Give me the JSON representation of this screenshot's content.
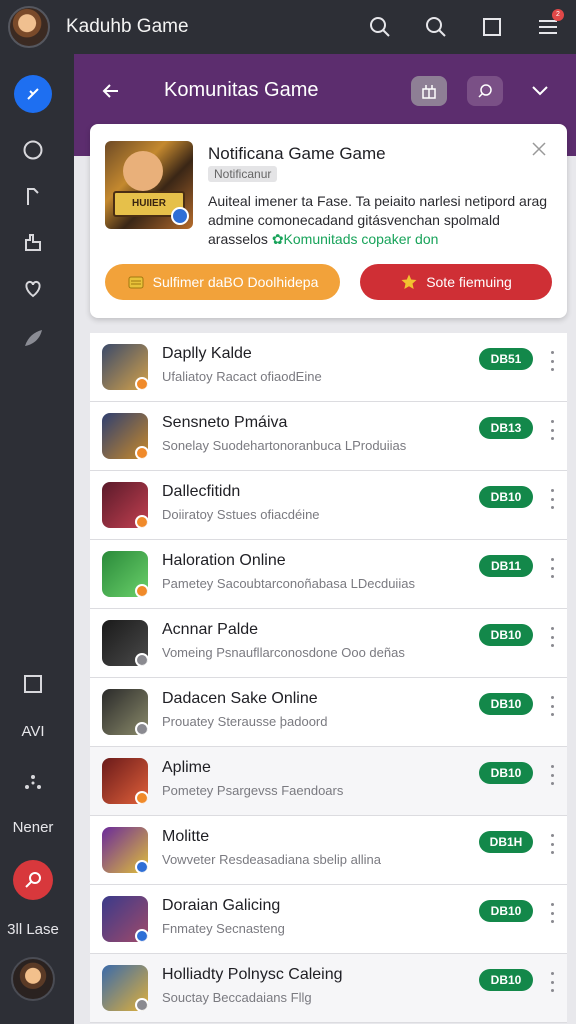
{
  "app_title": "Kaduhb Game",
  "topbar": {
    "icons": [
      "search-icon",
      "search-icon",
      "square-icon",
      "menu-icon"
    ],
    "badge": "2"
  },
  "rail": {
    "labels": {
      "avi": "AVI",
      "nener": "Nener",
      "lase": "3ll Lase"
    },
    "icons": [
      "compass-icon",
      "circle-icon",
      "bookmark-icon",
      "thumb-icon",
      "heart-icon",
      "leaf-icon",
      "square-icon",
      "dots-icon",
      "search-red-icon",
      "avatar"
    ]
  },
  "header": {
    "back_icon": "arrow-left-icon",
    "title": "Komunitas Game"
  },
  "notification": {
    "title": "Notificana Game Game",
    "subtitle": "Notificanur",
    "text_1": "Auiteal imener ta Fase. Ta peiaito narlesi netipord arag admine comonecadand gitásvenchan spolmald arasselos",
    "link": "✿Komunitads copaker don",
    "button_primary": "Sulfimer daBO Doolhidepa",
    "button_secondary": "Sote fiemuing",
    "image_tag": "HUIIER"
  },
  "colors": {
    "purple": "#5c2d6e",
    "accent_blue": "#1e6ff1",
    "green": "#13884a",
    "orange": "#f2a23a",
    "red": "#cf2f35"
  },
  "games": [
    {
      "name": "Daplly Kalde",
      "desc": "Ufaliatoy Racact ofiaodEine",
      "badge": "DB51",
      "sub": "#f08a2a",
      "icon": [
        "#3b4a6a",
        "#d4a24a"
      ]
    },
    {
      "name": "Sensneto Pmáiva",
      "desc": "Sonelay Suodehartonoranbuca LProduiias",
      "badge": "DB13",
      "sub": "#f08a2a",
      "icon": [
        "#2f3f70",
        "#c98a2a"
      ]
    },
    {
      "name": "Dallecfitidn",
      "desc": "Doiiratoy Sstues ofiacdéine",
      "badge": "DB10",
      "sub": "#f08a2a",
      "icon": [
        "#5a1a2a",
        "#c24050"
      ]
    },
    {
      "name": "Haloration Online",
      "desc": "Pametey Sacoubtarconoñabasa LDecduiias",
      "badge": "DB11",
      "sub": "#f08a2a",
      "icon": [
        "#2a8a3a",
        "#6ad06a"
      ]
    },
    {
      "name": "Acnnar Palde",
      "desc": "Vomeing Psnaufllarconosdone Ooo deñas",
      "badge": "DB10",
      "sub": "#8a8a90",
      "icon": [
        "#1a1a1a",
        "#4a4a4a"
      ]
    },
    {
      "name": "Dadacen Sake Online",
      "desc": "Prouatey Sterausse þadoord",
      "badge": "DB10",
      "sub": "#8a8a90",
      "icon": [
        "#2a2a2a",
        "#8a8a6a"
      ]
    },
    {
      "name": "Aplime",
      "desc": "Pometey Psargevss Faendoars",
      "badge": "DB10",
      "sub": "#f08a2a",
      "icon": [
        "#6a1a1a",
        "#e0603a"
      ]
    },
    {
      "name": "Molitte",
      "desc": "Vowveter Resdeasadiana sbelip allina",
      "badge": "DB1H",
      "sub": "#2f6fd6",
      "icon": [
        "#6a2a9a",
        "#e0c03a"
      ]
    },
    {
      "name": "Doraian Galicing",
      "desc": "Fnmatey Secnasteng",
      "badge": "DB10",
      "sub": "#2f6fd6",
      "icon": [
        "#3a3a8a",
        "#a04a6a"
      ]
    },
    {
      "name": "Holliadty Polnysc Caleing",
      "desc": "Souctay Beccadaians Fllg",
      "badge": "DB10",
      "sub": "#8a8a90",
      "icon": [
        "#3a6aaa",
        "#e0b03a"
      ]
    }
  ]
}
